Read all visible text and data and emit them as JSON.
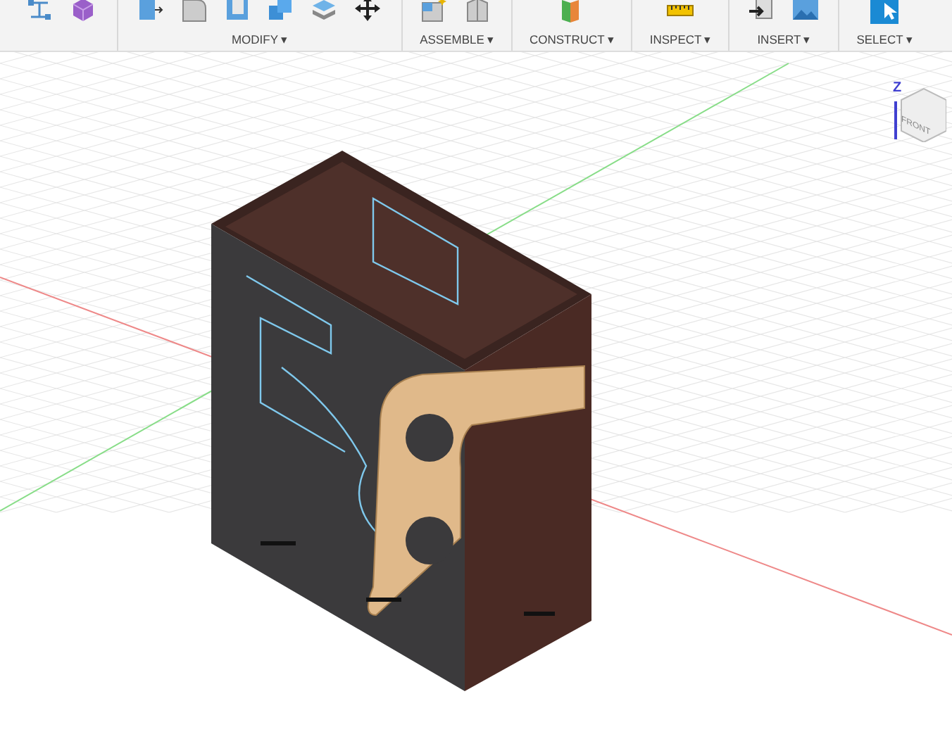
{
  "toolbar": {
    "groups": [
      {
        "tools": [
          {
            "kind": "sketch"
          },
          {
            "kind": "box"
          }
        ]
      },
      {
        "label": "MODIFY",
        "caret": "▾",
        "tools": [
          {
            "kind": "pull"
          },
          {
            "kind": "fillet"
          },
          {
            "kind": "shell"
          },
          {
            "kind": "combine"
          },
          {
            "kind": "layers"
          },
          {
            "kind": "move"
          }
        ]
      },
      {
        "label": "ASSEMBLE",
        "caret": "▾",
        "tools": [
          {
            "kind": "component"
          },
          {
            "kind": "joint"
          }
        ]
      },
      {
        "label": "CONSTRUCT",
        "caret": "▾",
        "tools": [
          {
            "kind": "plane"
          }
        ]
      },
      {
        "label": "INSPECT",
        "caret": "▾",
        "tools": [
          {
            "kind": "ruler"
          }
        ]
      },
      {
        "label": "INSERT",
        "caret": "▾",
        "tools": [
          {
            "kind": "insert"
          },
          {
            "kind": "image"
          }
        ]
      },
      {
        "label": "SELECT",
        "caret": "▾",
        "tools": [
          {
            "kind": "select"
          }
        ]
      }
    ]
  },
  "viewport": {
    "axis_label": "Z",
    "cube_label": "FRONT"
  }
}
